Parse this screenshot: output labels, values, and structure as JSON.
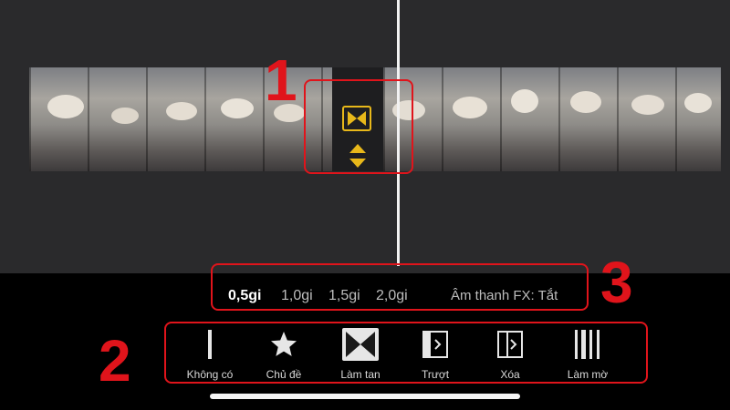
{
  "timeline": {
    "transition_icon": "bowtie-transition-icon",
    "adjust_icon": "up-down-arrows-icon",
    "accent_color": "#e8b81a"
  },
  "transition_durations": {
    "options": [
      "0,5gi",
      "1,0gi",
      "1,5gi",
      "2,0gi"
    ],
    "selected": "0,5gi",
    "audio_fx": "Âm thanh FX: Tắt"
  },
  "transition_styles": [
    {
      "label": "Không có",
      "icon": "none-line-icon"
    },
    {
      "label": "Chủ đề",
      "icon": "star-icon"
    },
    {
      "label": "Làm tan",
      "icon": "dissolve-bowtie-icon"
    },
    {
      "label": "Trượt",
      "icon": "slide-icon"
    },
    {
      "label": "Xóa",
      "icon": "wipe-icon"
    },
    {
      "label": "Làm mờ",
      "icon": "fade-bars-icon"
    }
  ],
  "annotations": {
    "callout_1": "1",
    "callout_2": "2",
    "callout_3": "3",
    "highlight_color": "#e0141b"
  }
}
